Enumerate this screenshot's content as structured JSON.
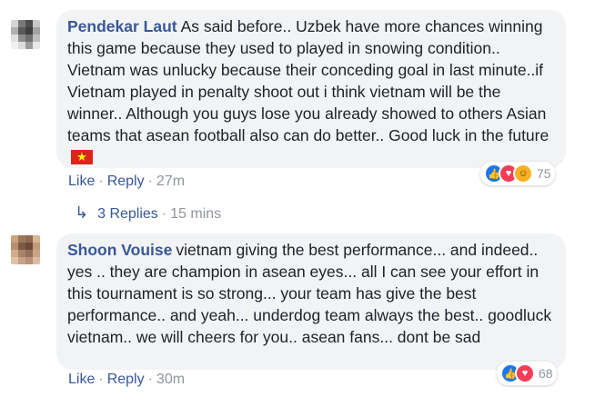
{
  "comments": [
    {
      "author": "Pendekar Laut",
      "text": "As said before.. Uzbek have more chances winning this game because they used to played in snowing condition.. Vietnam was unlucky because their conceding goal in last minute..if Vietnam played in penalty shoot out i think vietnam will be the winner.. Although you guys lose you already showed to others Asian teams that asean football also can do better.. Good luck in the future",
      "like_label": "Like",
      "reply_label": "Reply",
      "time": "27m",
      "reaction_count": "75",
      "reactions": [
        "like-icon",
        "love-icon",
        "haha-icon"
      ],
      "avatar_colors": [
        "#d6d6d6",
        "#7a7a7a",
        "#4d4d4d",
        "#c8c8c8",
        "#b0b0b0",
        "#5a5a5a",
        "#3f3f3f",
        "#a3a3a3",
        "#e0e0e0",
        "#8c8c8c",
        "#6f6f6f",
        "#bfbfbf",
        "#f0f0f0",
        "#dcdcdc",
        "#9a9a9a",
        "#e8e8e8"
      ]
    },
    {
      "author": "Shoon Vouise",
      "text": "vietnam giving the best performance... and indeed.. yes .. they are champion in asean eyes... all I can see your effort in this tournament is so strong... your team has give the best performance.. and yeah... underdog team always the best.. goodluck vietnam.. we will cheers for you.. asean fans... dont be sad",
      "like_label": "Like",
      "reply_label": "Reply",
      "time": "30m",
      "reaction_count": "68",
      "reactions": [
        "like-icon",
        "love-icon"
      ],
      "avatar_colors": [
        "#c9a27e",
        "#a0765a",
        "#8f6a54",
        "#d8b596",
        "#b88c6c",
        "#7e5a45",
        "#6b4a3a",
        "#c29a7a",
        "#d2ad8e",
        "#a98268",
        "#94705c",
        "#caa488",
        "#e1c2a6",
        "#c7a286",
        "#b89276",
        "#dbbba0"
      ]
    }
  ],
  "replies_link": {
    "label": "3 Replies",
    "time": "15 mins",
    "icon": "reply-arrow-icon"
  },
  "colors": {
    "link": "#385898",
    "meta": "#90949c",
    "bubble": "#f2f3f5",
    "like": "#1877f2",
    "love": "#f33e58",
    "haha": "#f7b125"
  }
}
